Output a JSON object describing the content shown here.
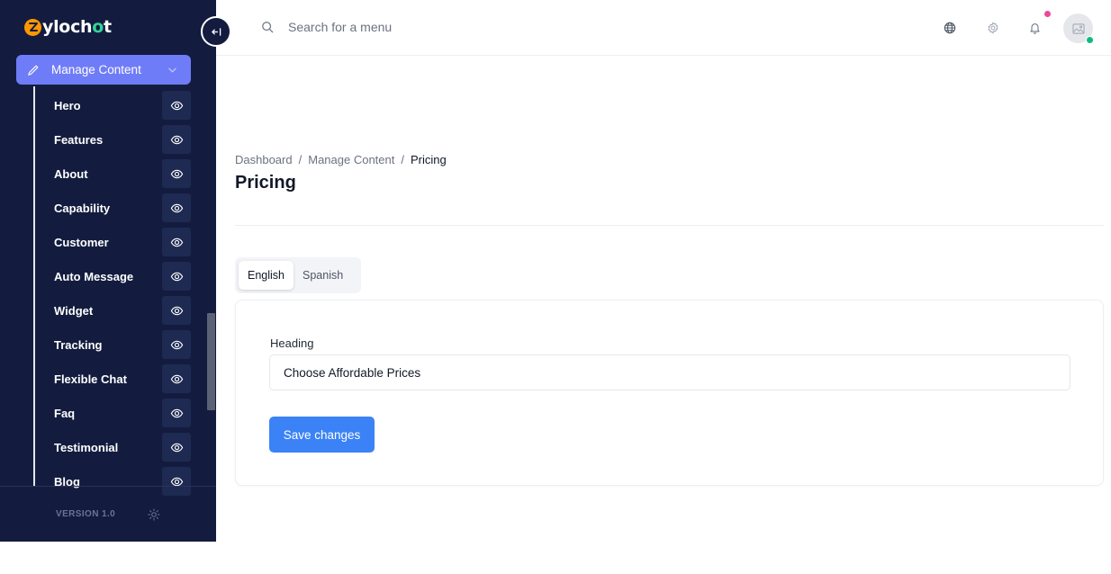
{
  "brand": {
    "name_prefix": "ylo",
    "name_mid": "ch",
    "name_o": "o",
    "name_suffix": "t"
  },
  "sidebar": {
    "active_menu": {
      "label": "Manage Content"
    },
    "items": [
      {
        "label": "Hero"
      },
      {
        "label": "Features"
      },
      {
        "label": "About"
      },
      {
        "label": "Capability"
      },
      {
        "label": "Customer"
      },
      {
        "label": "Auto Message"
      },
      {
        "label": "Widget"
      },
      {
        "label": "Tracking"
      },
      {
        "label": "Flexible Chat"
      },
      {
        "label": "Faq"
      },
      {
        "label": "Testimonial"
      },
      {
        "label": "Blog"
      }
    ],
    "version": "VERSION 1.0"
  },
  "topbar": {
    "search_placeholder": "Search for a menu"
  },
  "breadcrumb": {
    "items": [
      "Dashboard",
      "Manage Content"
    ],
    "current": "Pricing"
  },
  "page_title": "Pricing",
  "tabs": [
    {
      "label": "English",
      "active": true
    },
    {
      "label": "Spanish",
      "active": false
    }
  ],
  "form": {
    "heading_label": "Heading",
    "heading_value": "Choose Affordable Prices",
    "save_label": "Save changes"
  },
  "colors": {
    "sidebar_bg": "#131c3f",
    "active_menu_bg": "#6f7cf7",
    "primary_button": "#3b82f6",
    "notification_dot": "#ec4899",
    "online_dot": "#10b981",
    "logo_orange": "#ff9800"
  }
}
